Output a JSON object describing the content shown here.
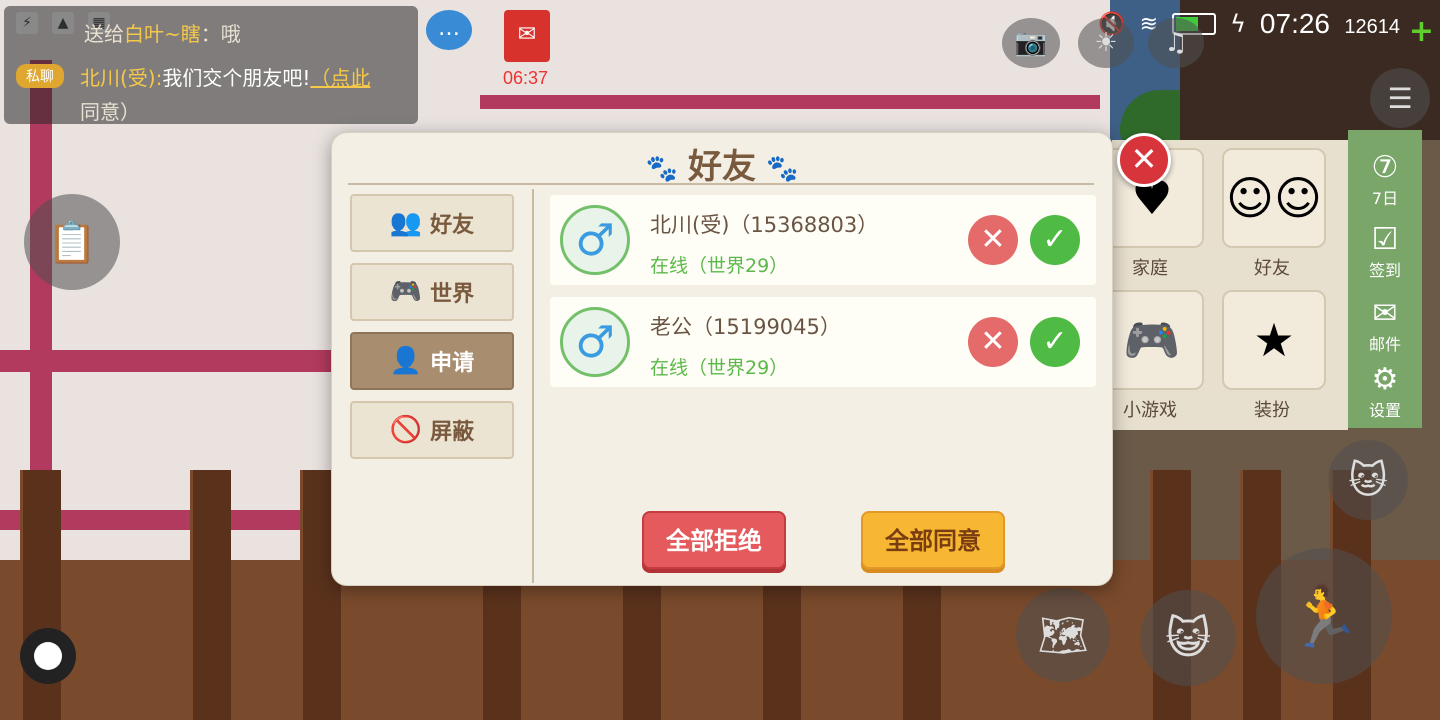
{
  "status_bar": {
    "time": "07:26",
    "coins": "12614",
    "battery_level": 0.7,
    "icons": [
      "shield-icon",
      "image-icon",
      "screenshot-icon",
      "mute-icon",
      "wifi-icon",
      "battery-icon",
      "charging-icon"
    ]
  },
  "chat": {
    "line1_prefix": "送给",
    "line1_name": "白叶~瞎",
    "line1_suffix": "：哦",
    "private_tag": "私聊",
    "line2_sender": "北川(受):",
    "line2_message": "我们交个朋友吧!",
    "line2_link": "（点此",
    "line3": "同意）"
  },
  "timer": "06:37",
  "friends_modal": {
    "title": "好友",
    "tabs": [
      {
        "label": "好友",
        "icon": "friends-icon"
      },
      {
        "label": "世界",
        "icon": "gamepad-icon"
      },
      {
        "label": "申请",
        "icon": "add-user-icon"
      },
      {
        "label": "屏蔽",
        "icon": "block-user-icon"
      }
    ],
    "active_tab": "申请",
    "requests": [
      {
        "name": "北川(受)（15368803）",
        "status": "在线（世界29）"
      },
      {
        "name": "老公（15199045）",
        "status": "在线（世界29）"
      }
    ],
    "reject_all_label": "全部拒绝",
    "accept_all_label": "全部同意"
  },
  "right_menu": {
    "items": [
      {
        "label": "家庭",
        "icon": "heart-icon"
      },
      {
        "label": "好友",
        "icon": "friends-faces-icon"
      },
      {
        "label": "小游戏",
        "icon": "gamepad-icon"
      },
      {
        "label": "装扮",
        "icon": "magic-wand-icon"
      }
    ],
    "side": [
      {
        "label": "7日",
        "icon": "seven-day-icon"
      },
      {
        "label": "签到",
        "icon": "checkin-icon"
      },
      {
        "label": "邮件",
        "icon": "mail-icon"
      },
      {
        "label": "设置",
        "icon": "gear-icon"
      }
    ]
  },
  "colors": {
    "modal_bg": "#f3efe4",
    "title_brown": "#7a5a3e",
    "online_green": "#5bb84a",
    "reject_red": "#e55a5c",
    "accept_orange": "#f7b732",
    "close_red": "#d8343b"
  }
}
